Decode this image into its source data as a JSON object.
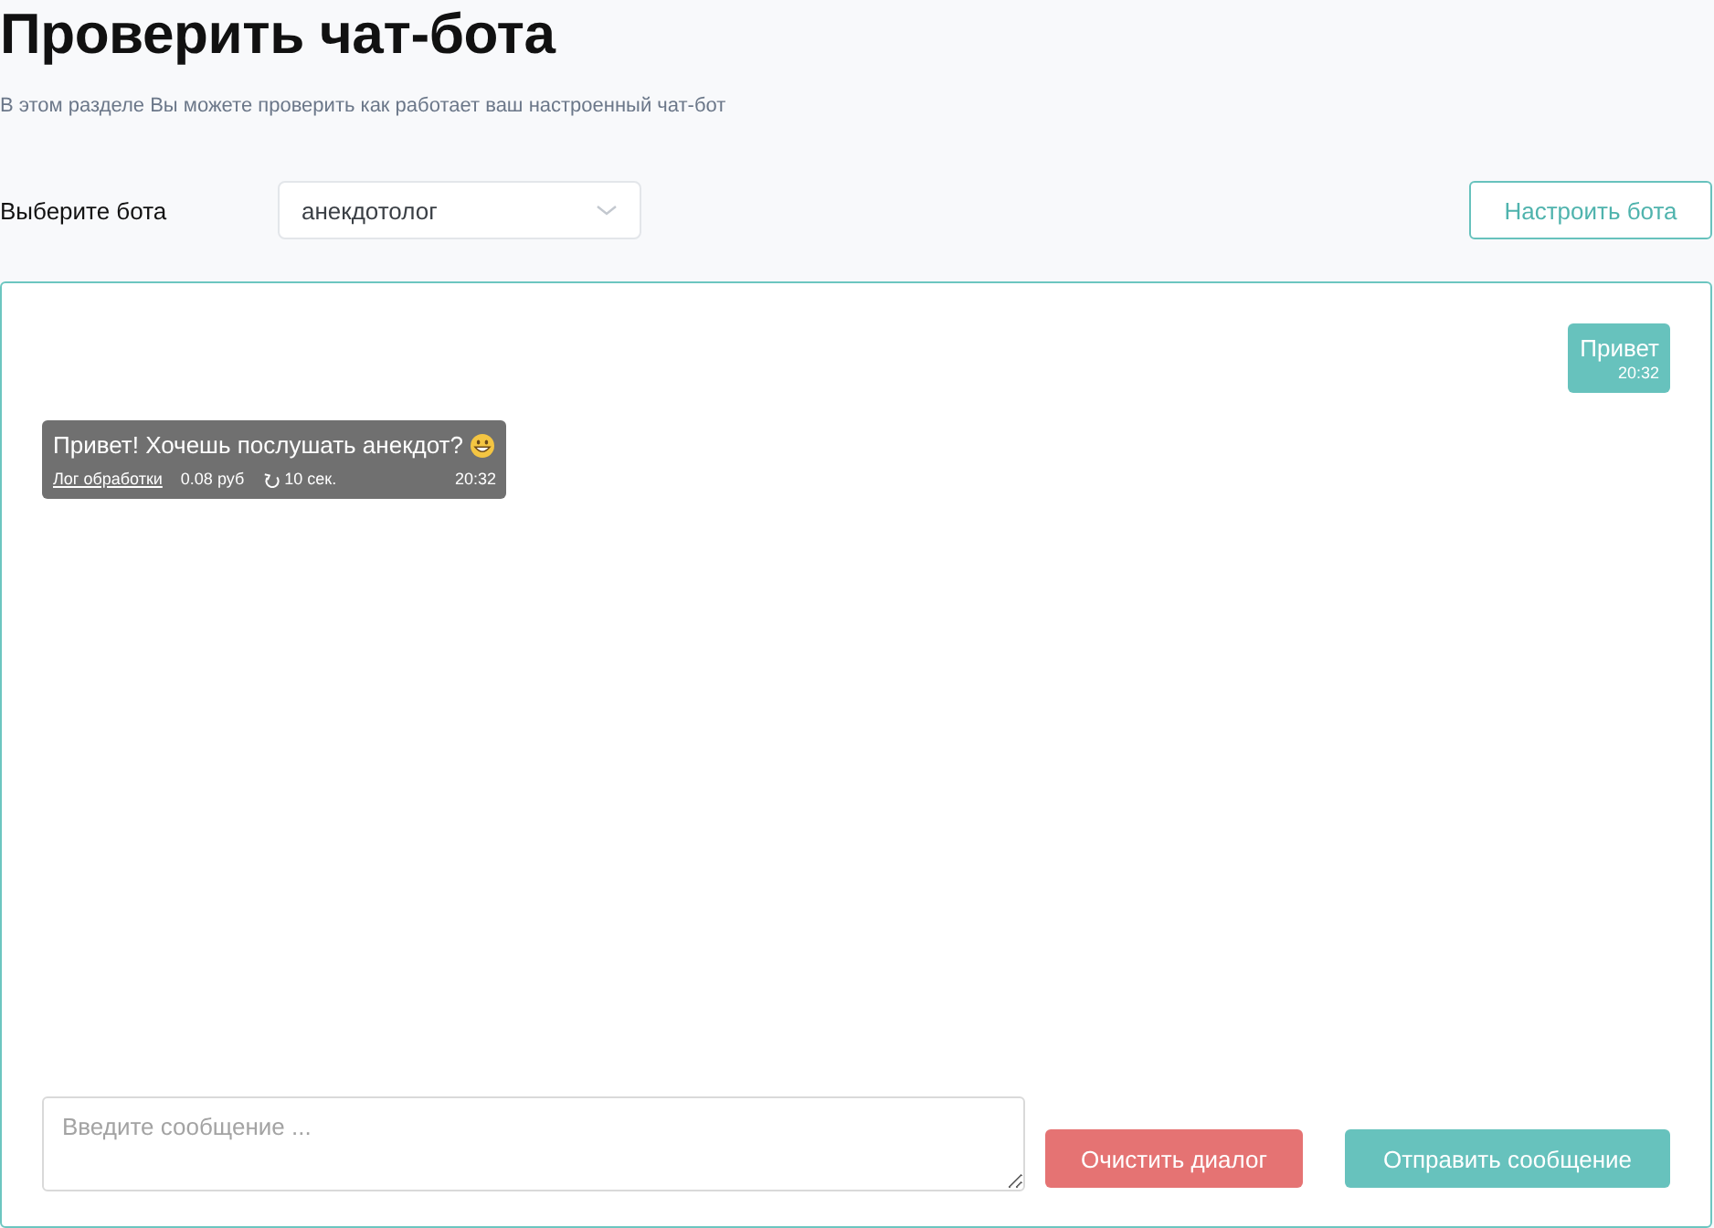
{
  "page": {
    "title": "Проверить чат-бота",
    "subtitle": "В этом разделе Вы можете проверить как работает ваш настроенный чат-бот"
  },
  "bot_selector": {
    "label": "Выберите бота",
    "value": "анекдотолог"
  },
  "configure_button": {
    "label": "Настроить бота"
  },
  "messages": [
    {
      "kind": "outgoing",
      "text": "Привет",
      "time": "20:32"
    },
    {
      "kind": "incoming",
      "text": "Привет! Хочешь послушать анекдот?",
      "log_link": "Лог обработки",
      "cost": "0.08 руб",
      "duration": "10 сек.",
      "time": "20:32"
    }
  ],
  "composer": {
    "placeholder": "Введите сообщение ...",
    "buttons": [
      {
        "kind": "danger",
        "label": "Очистить диалог"
      },
      {
        "kind": "primary",
        "label": "Отправить сообщение"
      }
    ]
  }
}
